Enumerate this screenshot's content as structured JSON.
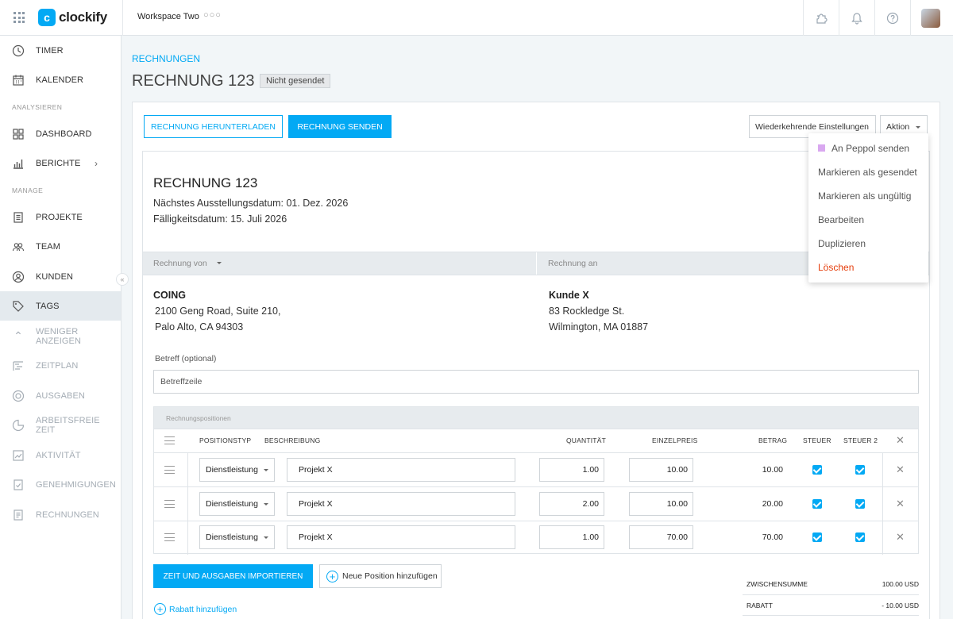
{
  "topbar": {
    "app_name": "clockify",
    "logo_mark": "c",
    "workspace": "Workspace Two",
    "workspace_more": "○○○",
    "icons": [
      "puzzle-icon",
      "bell-icon",
      "help-icon"
    ]
  },
  "sidebar": {
    "items": [
      {
        "label": "TIMER",
        "icon": "clock-icon"
      },
      {
        "label": "KALENDER",
        "icon": "calendar-icon"
      },
      {
        "label": "DASHBOARD",
        "icon": "dashboard-icon"
      },
      {
        "label": "BERICHTE",
        "icon": "chart-icon"
      },
      {
        "label": "PROJEKTE",
        "icon": "document-icon"
      },
      {
        "label": "TEAM",
        "icon": "team-icon"
      },
      {
        "label": "KUNDEN",
        "icon": "user-circle-icon"
      },
      {
        "label": "TAGS",
        "icon": "tag-icon"
      },
      {
        "label": "WENIGER ANZEIGEN",
        "icon": "chevron-up-icon"
      },
      {
        "label": "ZEITPLAN",
        "icon": "schedule-icon"
      },
      {
        "label": "AUSGABEN",
        "icon": "expenses-icon"
      },
      {
        "label": "ARBEITSFREIE ZEIT",
        "icon": "time-off-icon"
      },
      {
        "label": "AKTIVITÄT",
        "icon": "activity-icon"
      },
      {
        "label": "GENEHMIGUNGEN",
        "icon": "approvals-icon"
      },
      {
        "label": "RECHNUNGEN",
        "icon": "invoice-icon"
      }
    ],
    "section_analyze": "ANALYSIEREN",
    "section_manage": "MANAGE"
  },
  "page": {
    "breadcrumb": "RECHNUNGEN",
    "title": "RECHNUNG 123",
    "status_badge": "Nicht gesendet"
  },
  "toolbar": {
    "download": "RECHNUNG HERUNTERLADEN",
    "send": "RECHNUNG SENDEN",
    "recurring": "Wiederkehrende Einstellungen",
    "action": "Aktion"
  },
  "action_menu": {
    "items": [
      "An Peppol senden",
      "Markieren als gesendet",
      "Markieren als ungültig",
      "Bearbeiten",
      "Duplizieren",
      "Löschen"
    ]
  },
  "invoice": {
    "title": "RECHNUNG 123",
    "next_issue": "Nächstes Ausstellungsdatum: 01. Dez. 2026",
    "due": "Fälligkeitsdatum: 15. Juli 2026",
    "from_label": "Rechnung von",
    "to_label": "Rechnung an",
    "from": {
      "name": "COING",
      "line1": "2100 Geng Road, Suite 210,",
      "line2": "Palo Alto, CA 94303"
    },
    "to": {
      "name": "Kunde X",
      "line1": "83 Rockledge St.",
      "line2": "Wilmington, MA 01887"
    },
    "subject_label": "Betreff (optional)",
    "subject_placeholder": "Betreffzeile"
  },
  "positions": {
    "section_title": "Rechnungspositionen",
    "columns": [
      "POSITIONSTYP",
      "BESCHREIBUNG",
      "QUANTITÄT",
      "EINZELPREIS",
      "BETRAG",
      "STEUER",
      "STEUER 2"
    ],
    "rows": [
      {
        "type": "Dienstleistung",
        "description": "Projekt X",
        "quantity": "1.00",
        "unit_price": "10.00",
        "amount": "10.00",
        "tax": true,
        "tax2": true
      },
      {
        "type": "Dienstleistung",
        "description": "Projekt X",
        "quantity": "2.00",
        "unit_price": "10.00",
        "amount": "20.00",
        "tax": true,
        "tax2": true
      },
      {
        "type": "Dienstleistung",
        "description": "Projekt X",
        "quantity": "1.00",
        "unit_price": "70.00",
        "amount": "70.00",
        "tax": true,
        "tax2": true
      }
    ],
    "import_button": "ZEIT UND AUSGABEN IMPORTIEREN",
    "add_position": "Neue Position hinzufügen",
    "add_discount": "Rabatt hinzufügen"
  },
  "totals": {
    "subtotal_label": "ZWISCHENSUMME",
    "subtotal": "100.00 USD",
    "discount_label": "RABATT",
    "discount": "- 10.00 USD"
  },
  "colors": {
    "accent": "#03a9f4",
    "danger": "#e53e0c",
    "peppol": "#d9a8f0"
  }
}
